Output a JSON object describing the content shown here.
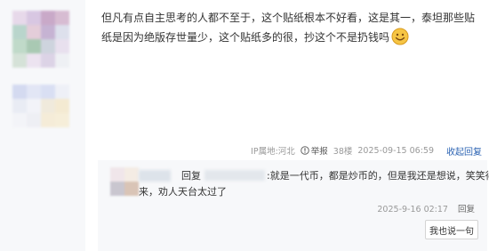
{
  "post": {
    "text": "但凡有点自主思考的人都不至于，这个贴纸根本不好看，这是其一，泰坦那些贴纸是因为绝版存世量少，这个贴纸多的很，抄这个不是扔钱吗",
    "emoji_icon": "smile-icon"
  },
  "meta": {
    "ip": "IP属地:河北",
    "report": "举报",
    "floor": "38楼",
    "time": "2025-09-15 06:59",
    "collapse": "收起回复"
  },
  "reply": {
    "prefix": "回复",
    "text_line1": ":就是一代币，都是炒币的，但是我还是想说，笑笑得",
    "text_line2": "来，劝人天台太过了",
    "time": "2025-9-16 02:17",
    "reply_label": "回复",
    "say_button": "我也说一句"
  },
  "colors": {
    "link": "#2d64b3",
    "meta_gray": "#999999",
    "reply_bg": "#f7f8fa"
  }
}
